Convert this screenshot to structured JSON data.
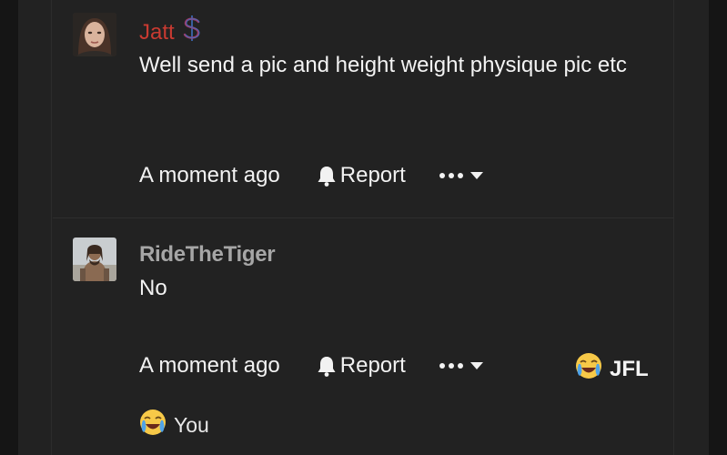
{
  "comments": [
    {
      "author": "Jatt",
      "author_badge": "dollar-badge-icon",
      "author_color": "#c93a31",
      "message": "Well send a pic and height weight physique pic etc",
      "timestamp": "A moment ago",
      "report_label": "Report"
    },
    {
      "author": "RideTheTiger",
      "author_color": "#a6a6a6",
      "message": "No",
      "timestamp": "A moment ago",
      "report_label": "Report",
      "reaction_summary": {
        "emoji": "😭",
        "label": "JFL"
      },
      "your_reaction": {
        "emoji": "😭",
        "label": "You"
      }
    }
  ],
  "colors": {
    "background": "#151515",
    "panel": "#222222",
    "text": "#f2f2f2",
    "author_red": "#c93a31"
  }
}
